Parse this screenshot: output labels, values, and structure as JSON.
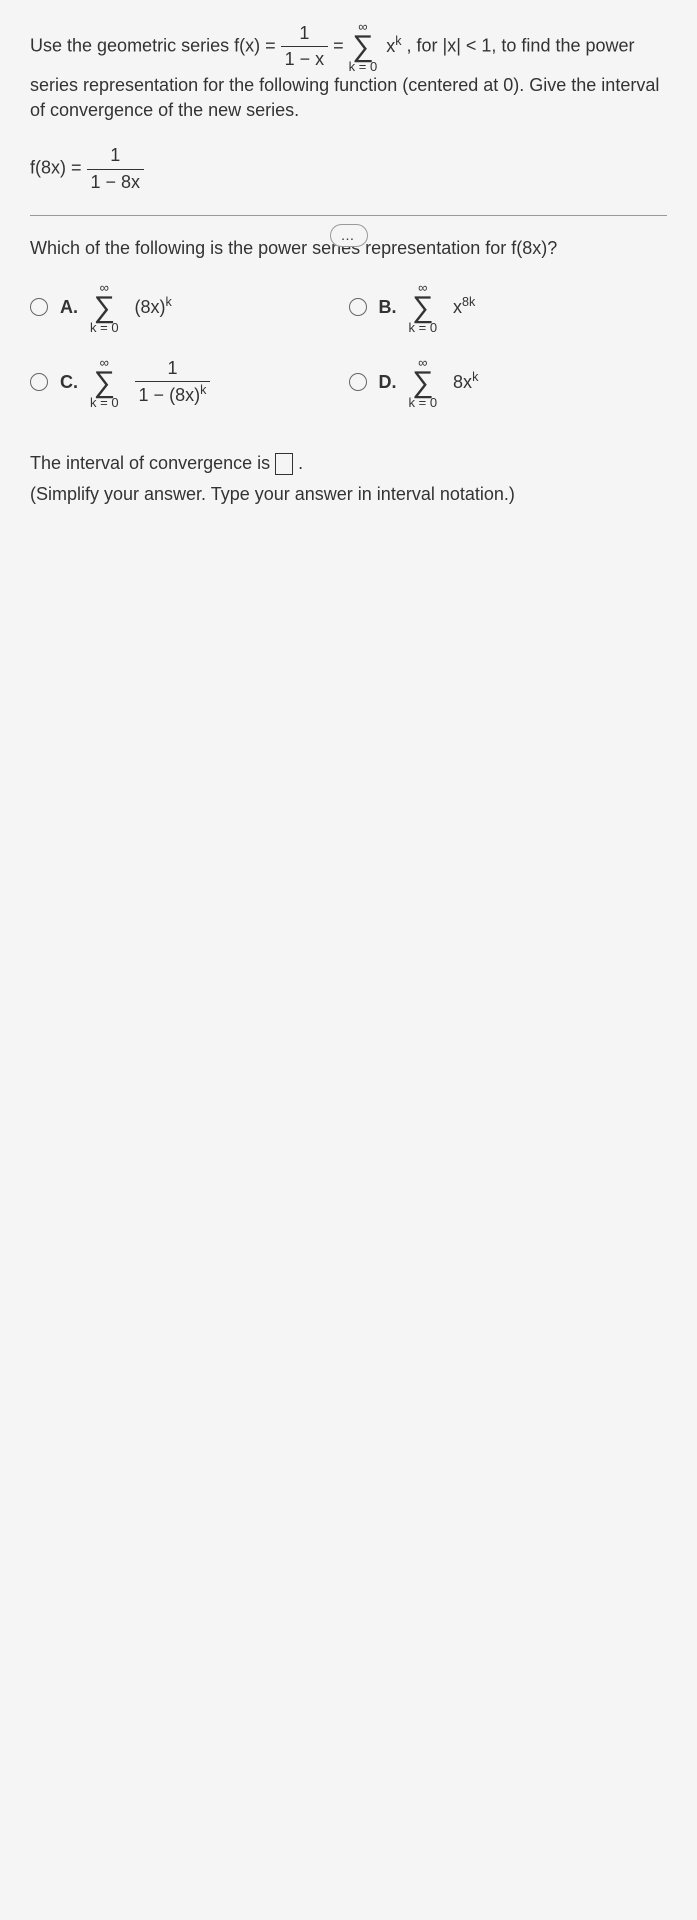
{
  "intro_prefix": "Use the geometric series f(x) = ",
  "geo_frac_num": "1",
  "geo_frac_den": "1 − x",
  "eq_sign": " = ",
  "sigma_top": "∞",
  "sigma_bottom": "k = 0",
  "sigma_term": "x",
  "sigma_exp": "k",
  "intro_suffix": ", for |x| < 1, to find the power series representation for the following function (centered at 0). Give the interval of convergence of the new series.",
  "given_lhs": "f(8x) = ",
  "given_num": "1",
  "given_den": "1 − 8x",
  "dots": "…",
  "subq": "Which of the following is the power series representation for f(8x)?",
  "choices": {
    "A": {
      "label": "A.",
      "sum_top": "∞",
      "sum_bot": "k = 0",
      "term": "(8x)",
      "exp": "k"
    },
    "B": {
      "label": "B.",
      "sum_top": "∞",
      "sum_bot": "k = 0",
      "term": "x",
      "exp": "8k"
    },
    "C": {
      "label": "C.",
      "sum_top": "∞",
      "sum_bot": "k = 0",
      "frac_num": "1",
      "frac_den_base": "1 − (8x)",
      "frac_den_exp": "k"
    },
    "D": {
      "label": "D.",
      "sum_top": "∞",
      "sum_bot": "k = 0",
      "term": "8x",
      "exp": "k"
    }
  },
  "interval_text_pre": "The interval of convergence is ",
  "interval_text_post": ".",
  "hint": "(Simplify your answer. Type your answer in interval notation.)"
}
